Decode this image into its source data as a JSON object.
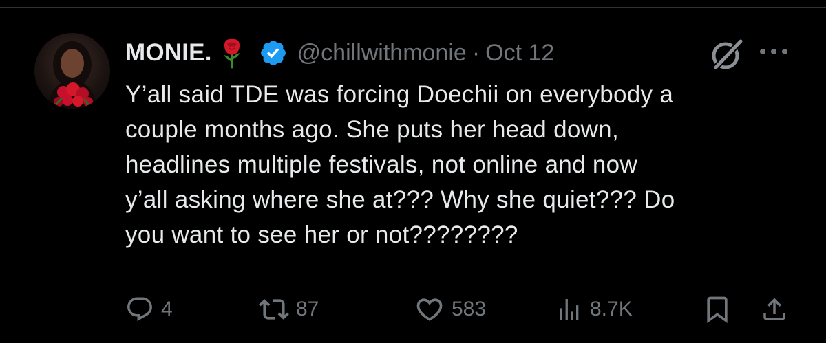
{
  "author": {
    "display_name": "MONIE.",
    "name_emoji": "rose-icon",
    "verified": true,
    "handle": "@chillwithmonie",
    "separator": "·",
    "date": "Oct 12"
  },
  "tweet": {
    "text": "Y’all said TDE was forcing Doechii on everybody a\ncouple months ago. She puts her head down,\nheadlines multiple festivals, not online and now\ny’all asking where she at??? Why she quiet??? Do\nyou want to see her or not????????"
  },
  "actions": {
    "replies": "4",
    "reposts": "87",
    "likes": "583",
    "views": "8.7K"
  },
  "colors": {
    "background": "#000000",
    "text_primary": "#e7e9ea",
    "text_secondary": "#71767b",
    "verified_blue": "#1d9bf0",
    "divider": "#2f3336",
    "rose_red": "#d4182a"
  }
}
